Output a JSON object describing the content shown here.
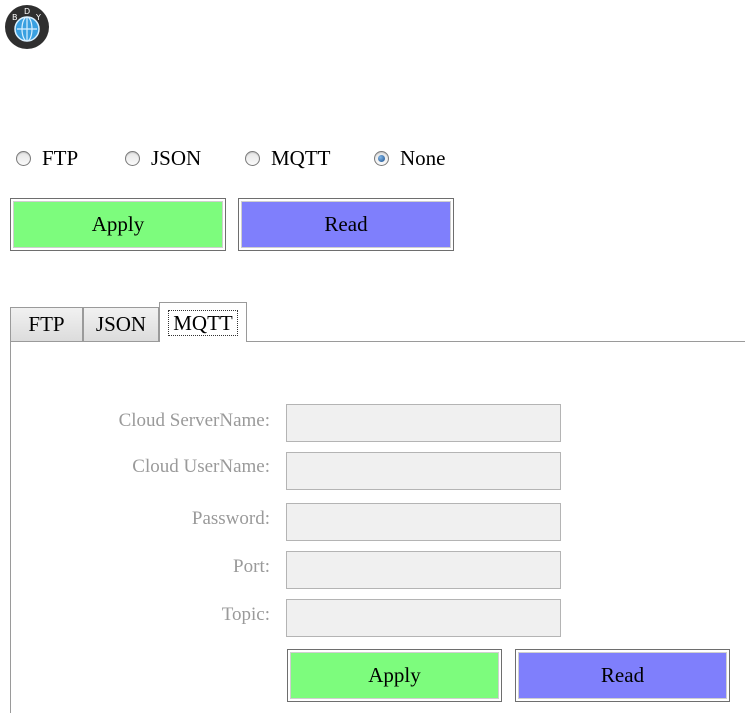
{
  "logo": {
    "letters": [
      "B",
      "D",
      "Y"
    ],
    "icon": "globe-logo-icon"
  },
  "protocol": {
    "options": [
      {
        "label": "FTP",
        "selected": false
      },
      {
        "label": "JSON",
        "selected": false
      },
      {
        "label": "MQTT",
        "selected": false
      },
      {
        "label": "None",
        "selected": true
      }
    ]
  },
  "actions": {
    "apply_label": "Apply",
    "read_label": "Read"
  },
  "tabs": [
    {
      "label": "FTP",
      "active": false
    },
    {
      "label": "JSON",
      "active": false
    },
    {
      "label": "MQTT",
      "active": true
    }
  ],
  "mqtt_form": {
    "fields": [
      {
        "label": "Cloud ServerName:",
        "value": ""
      },
      {
        "label": "Cloud UserName:",
        "value": ""
      },
      {
        "label": "Password:",
        "value": ""
      },
      {
        "label": "Port:",
        "value": ""
      },
      {
        "label": "Topic:",
        "value": ""
      }
    ],
    "apply_label": "Apply",
    "read_label": "Read"
  },
  "colors": {
    "apply": "#7dfc7d",
    "read": "#7f7ffc",
    "disabled_text": "#9a9a9a"
  }
}
